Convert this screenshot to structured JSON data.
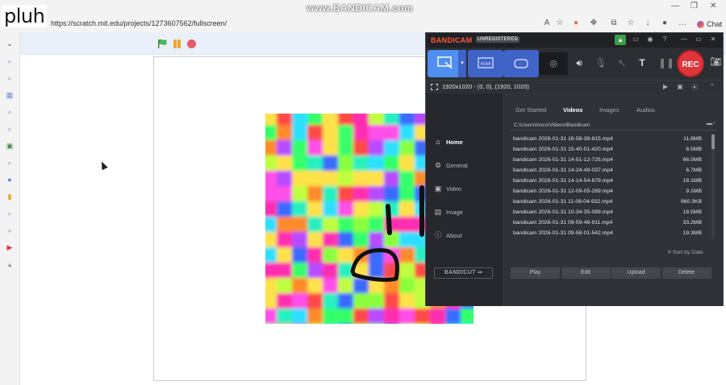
{
  "watermark": {
    "corner_text": "pluh",
    "recorder_text": "www.BANDICAM.com"
  },
  "browser": {
    "url": "https://scratch.mit.edu/projects/1273607562/fullscreen/",
    "chat_label": "Chat"
  },
  "scratch": {
    "controls": [
      "green-flag",
      "pause",
      "stop"
    ]
  },
  "bandicam": {
    "brand": "BANDICAM",
    "registration": "UNREGISTERED",
    "rec_label": "REC",
    "resolution": "1920x1020 - (0, 0), (1920, 1020)",
    "nav": [
      {
        "label": "Home",
        "icon": "home-icon",
        "active": true
      },
      {
        "label": "General",
        "icon": "gear-icon",
        "active": false
      },
      {
        "label": "Video",
        "icon": "video-icon",
        "active": false
      },
      {
        "label": "Image",
        "icon": "image-icon",
        "active": false
      },
      {
        "label": "About",
        "icon": "info-icon",
        "active": false
      }
    ],
    "bandicut_label": "BANDICUT",
    "tabs": [
      "Get Started",
      "Videos",
      "Images",
      "Audios"
    ],
    "active_tab": "Videos",
    "path": "C:\\Users\\losco\\Videos\\Bandicam",
    "files": [
      {
        "name": "bandicam 2026-01-31 16-58-38-815.mp4",
        "size": "11.8MB"
      },
      {
        "name": "bandicam 2026-01-31 15-40-01-420.mp4",
        "size": "8.5MB"
      },
      {
        "name": "bandicam 2026-01-31 14-51-12-725.mp4",
        "size": "66.0MB"
      },
      {
        "name": "bandicam 2026-01-31 14-24-49-037.mp4",
        "size": "6.7MB"
      },
      {
        "name": "bandicam 2026-01-31 14-14-54-679.mp4",
        "size": "18.1MB"
      },
      {
        "name": "bandicam 2026-01-31 12-09-05-289.mp4",
        "size": "9.1MB"
      },
      {
        "name": "bandicam 2026-01-31 11-08-04-932.mp4",
        "size": "960.3KB"
      },
      {
        "name": "bandicam 2026-01-31 10-34-35-089.mp4",
        "size": "18.5MB"
      },
      {
        "name": "bandicam 2026-01-31 09-59-46-911.mp4",
        "size": "33.2MB"
      },
      {
        "name": "bandicam 2026-01-31 09-58-01-542.mp4",
        "size": "19.3MB"
      }
    ],
    "sort_label": "Sort by Date",
    "actions": [
      "Play",
      "Edit",
      "Upload",
      "Delete"
    ]
  }
}
